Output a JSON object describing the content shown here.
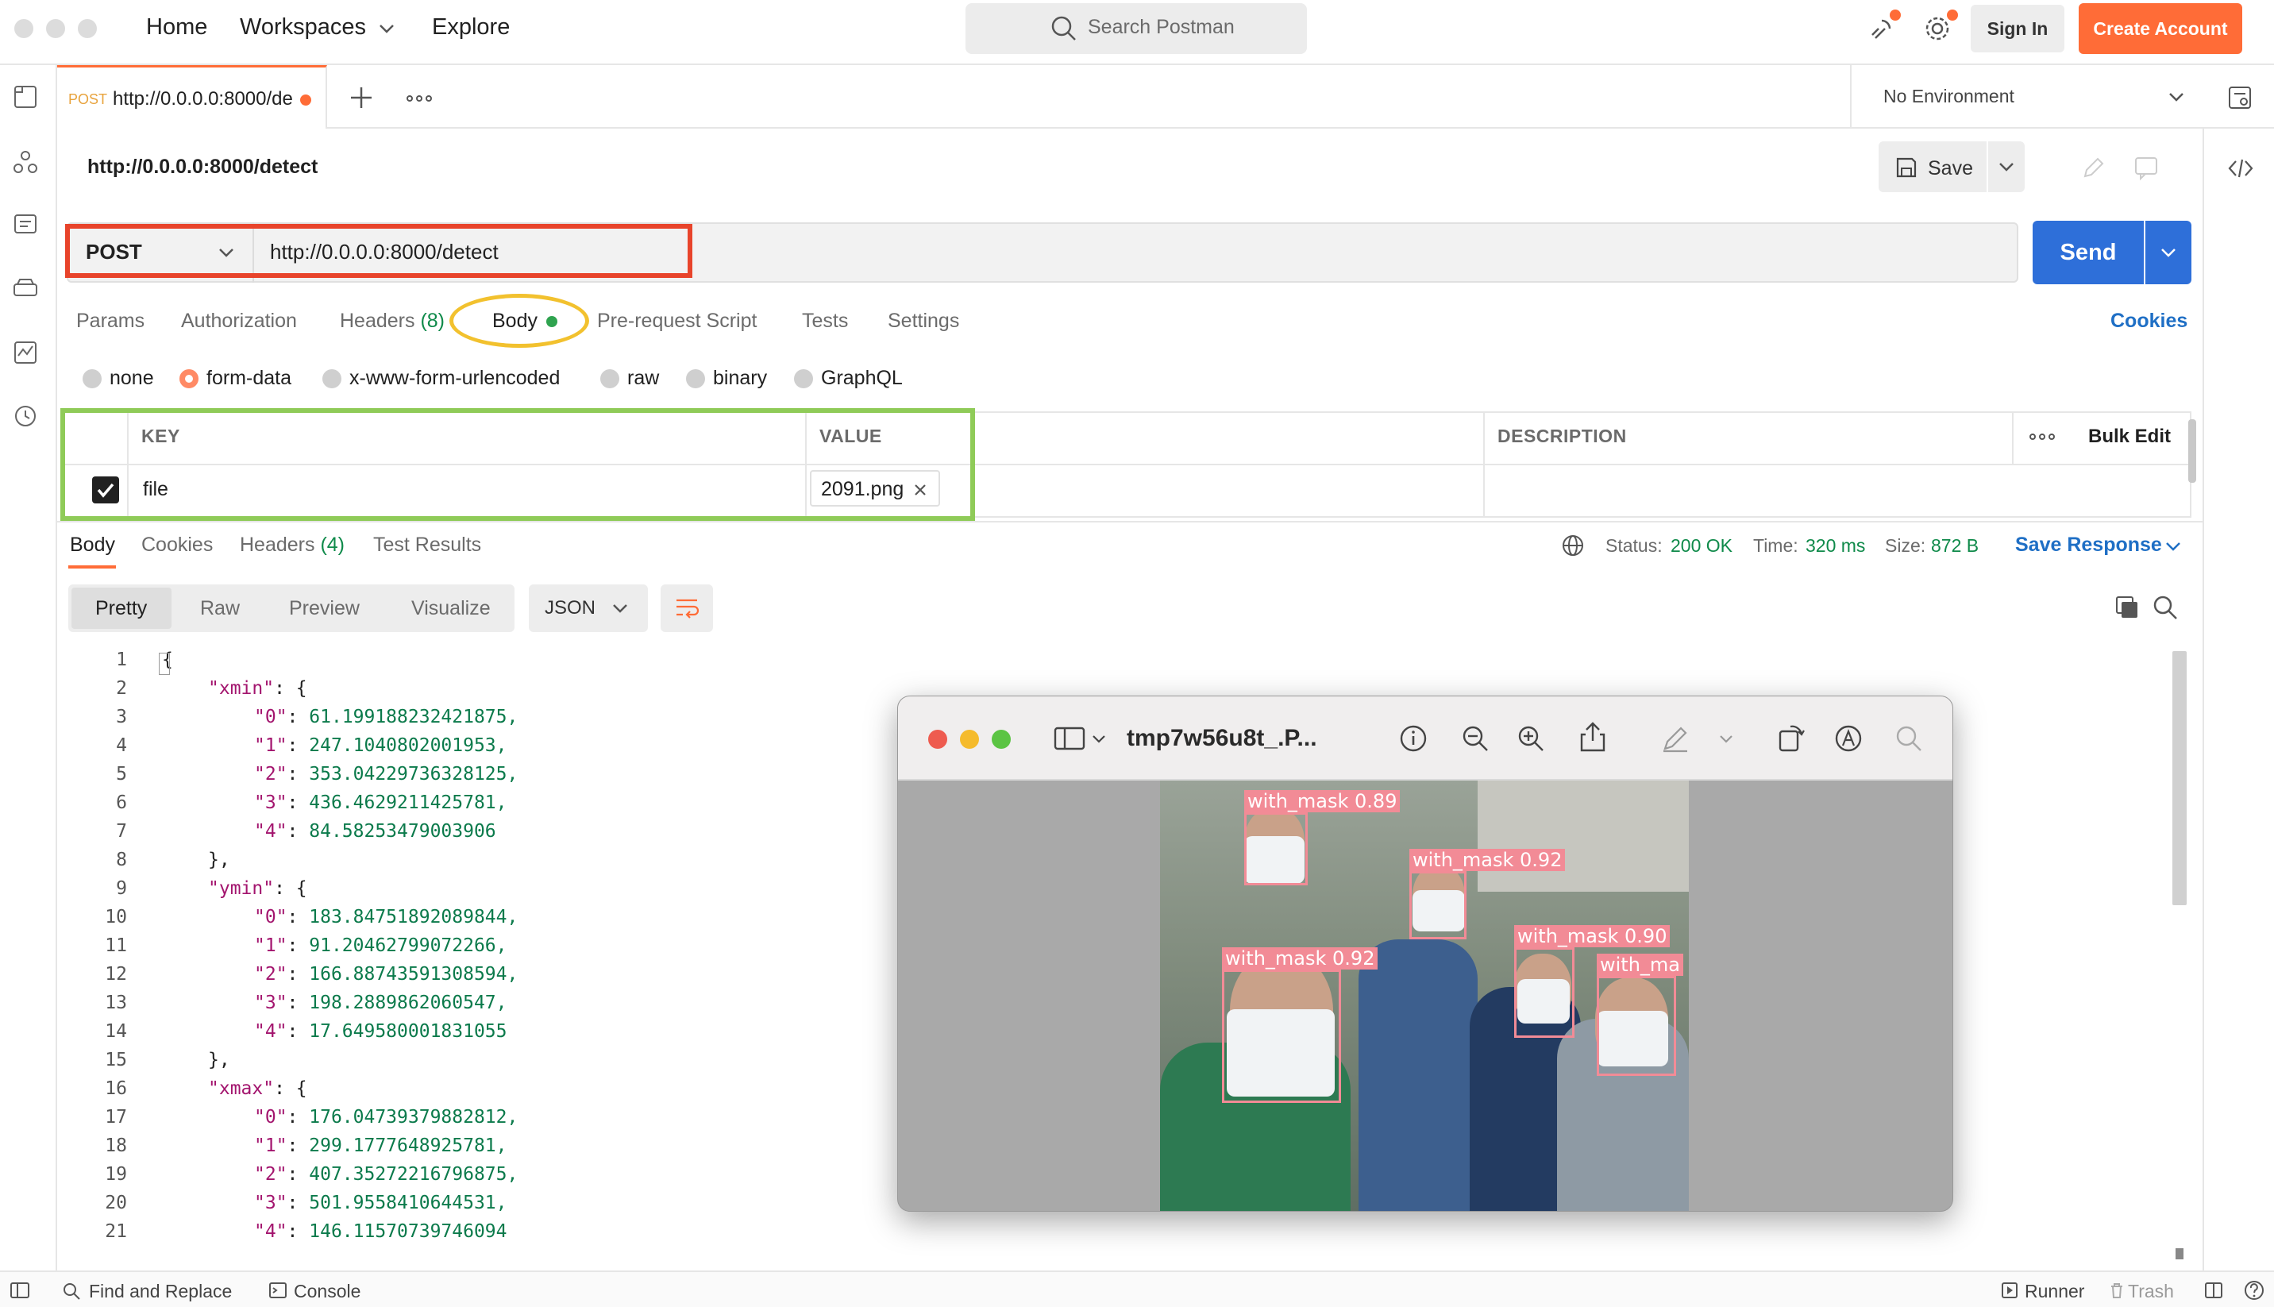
{
  "topbar": {
    "nav": {
      "home": "Home",
      "workspaces": "Workspaces",
      "explore": "Explore"
    },
    "search_placeholder": "Search Postman",
    "sign_in": "Sign In",
    "create_account": "Create Account"
  },
  "tabs": {
    "active_method": "POST",
    "active_url": "http://0.0.0.0:8000/de",
    "environment": "No Environment"
  },
  "request": {
    "title": "http://0.0.0.0:8000/detect",
    "save_label": "Save",
    "method": "POST",
    "url": "http://0.0.0.0:8000/detect",
    "send_label": "Send",
    "tabs": {
      "params": "Params",
      "authorization": "Authorization",
      "headers": "Headers",
      "headers_count": "(8)",
      "body": "Body",
      "prerequest": "Pre-request Script",
      "tests": "Tests",
      "settings": "Settings"
    },
    "cookies_link": "Cookies",
    "body_modes": {
      "none": "none",
      "form_data": "form-data",
      "urlencoded": "x-www-form-urlencoded",
      "raw": "raw",
      "binary": "binary",
      "graphql": "GraphQL"
    },
    "body_mode_selected": "form-data",
    "table": {
      "col_key": "KEY",
      "col_value": "VALUE",
      "col_description": "DESCRIPTION",
      "bulk_edit": "Bulk Edit",
      "row": {
        "key": "file",
        "value": "2091.png",
        "checked": true
      }
    }
  },
  "response": {
    "tabs": {
      "body": "Body",
      "cookies": "Cookies",
      "headers": "Headers",
      "headers_count": "(4)",
      "test_results": "Test Results"
    },
    "status_label": "Status:",
    "status_value": "200 OK",
    "time_label": "Time:",
    "time_value": "320 ms",
    "size_label": "Size:",
    "size_value": "872 B",
    "save_response": "Save Response",
    "format_tabs": {
      "pretty": "Pretty",
      "raw": "Raw",
      "preview": "Preview",
      "visualize": "Visualize"
    },
    "format_type": "JSON",
    "code_lines": [
      {
        "n": "1",
        "key": "",
        "text": "{"
      },
      {
        "n": "2",
        "key": "\"xmin\"",
        "text": ": {"
      },
      {
        "n": "3",
        "key": "\"0\"",
        "text": ": 61.199188232421875,"
      },
      {
        "n": "4",
        "key": "\"1\"",
        "text": ": 247.1040802001953,"
      },
      {
        "n": "5",
        "key": "\"2\"",
        "text": ": 353.04229736328125,"
      },
      {
        "n": "6",
        "key": "\"3\"",
        "text": ": 436.4629211425781,"
      },
      {
        "n": "7",
        "key": "\"4\"",
        "text": ": 84.58253479003906"
      },
      {
        "n": "8",
        "key": "",
        "text": "},"
      },
      {
        "n": "9",
        "key": "\"ymin\"",
        "text": ": {"
      },
      {
        "n": "10",
        "key": "\"0\"",
        "text": ": 183.84751892089844,"
      },
      {
        "n": "11",
        "key": "\"1\"",
        "text": ": 91.20462799072266,"
      },
      {
        "n": "12",
        "key": "\"2\"",
        "text": ": 166.88743591308594,"
      },
      {
        "n": "13",
        "key": "\"3\"",
        "text": ": 198.2889862060547,"
      },
      {
        "n": "14",
        "key": "\"4\"",
        "text": ": 17.649580001831055"
      },
      {
        "n": "15",
        "key": "",
        "text": "},"
      },
      {
        "n": "16",
        "key": "\"xmax\"",
        "text": ": {"
      },
      {
        "n": "17",
        "key": "\"0\"",
        "text": ": 176.04739379882812,"
      },
      {
        "n": "18",
        "key": "\"1\"",
        "text": ": 299.1777648925781,"
      },
      {
        "n": "19",
        "key": "\"2\"",
        "text": ": 407.35272216796875,"
      },
      {
        "n": "20",
        "key": "\"3\"",
        "text": ": 501.9558410644531,"
      },
      {
        "n": "21",
        "key": "\"4\"",
        "text": ": 146.11570739746094"
      }
    ]
  },
  "preview_window": {
    "title": "tmp7w56u8t_.P...",
    "detections": [
      {
        "label": "with_mask 0.89"
      },
      {
        "label": "with_mask 0.92"
      },
      {
        "label": "with_mask 0.92"
      },
      {
        "label": "with_mask 0.90"
      },
      {
        "label": "with_ma"
      }
    ]
  },
  "bottombar": {
    "find_replace": "Find and Replace",
    "console": "Console",
    "runner": "Runner",
    "trash": "Trash"
  },
  "colors": {
    "brand_orange": "#ff6c37",
    "send_blue": "#2e6fd9",
    "highlight_red": "#e8442b",
    "highlight_yellow": "#f2c12e",
    "highlight_green": "#8fcb58",
    "status_green": "#0f8a4a",
    "detection_pink": "#f28b96"
  }
}
